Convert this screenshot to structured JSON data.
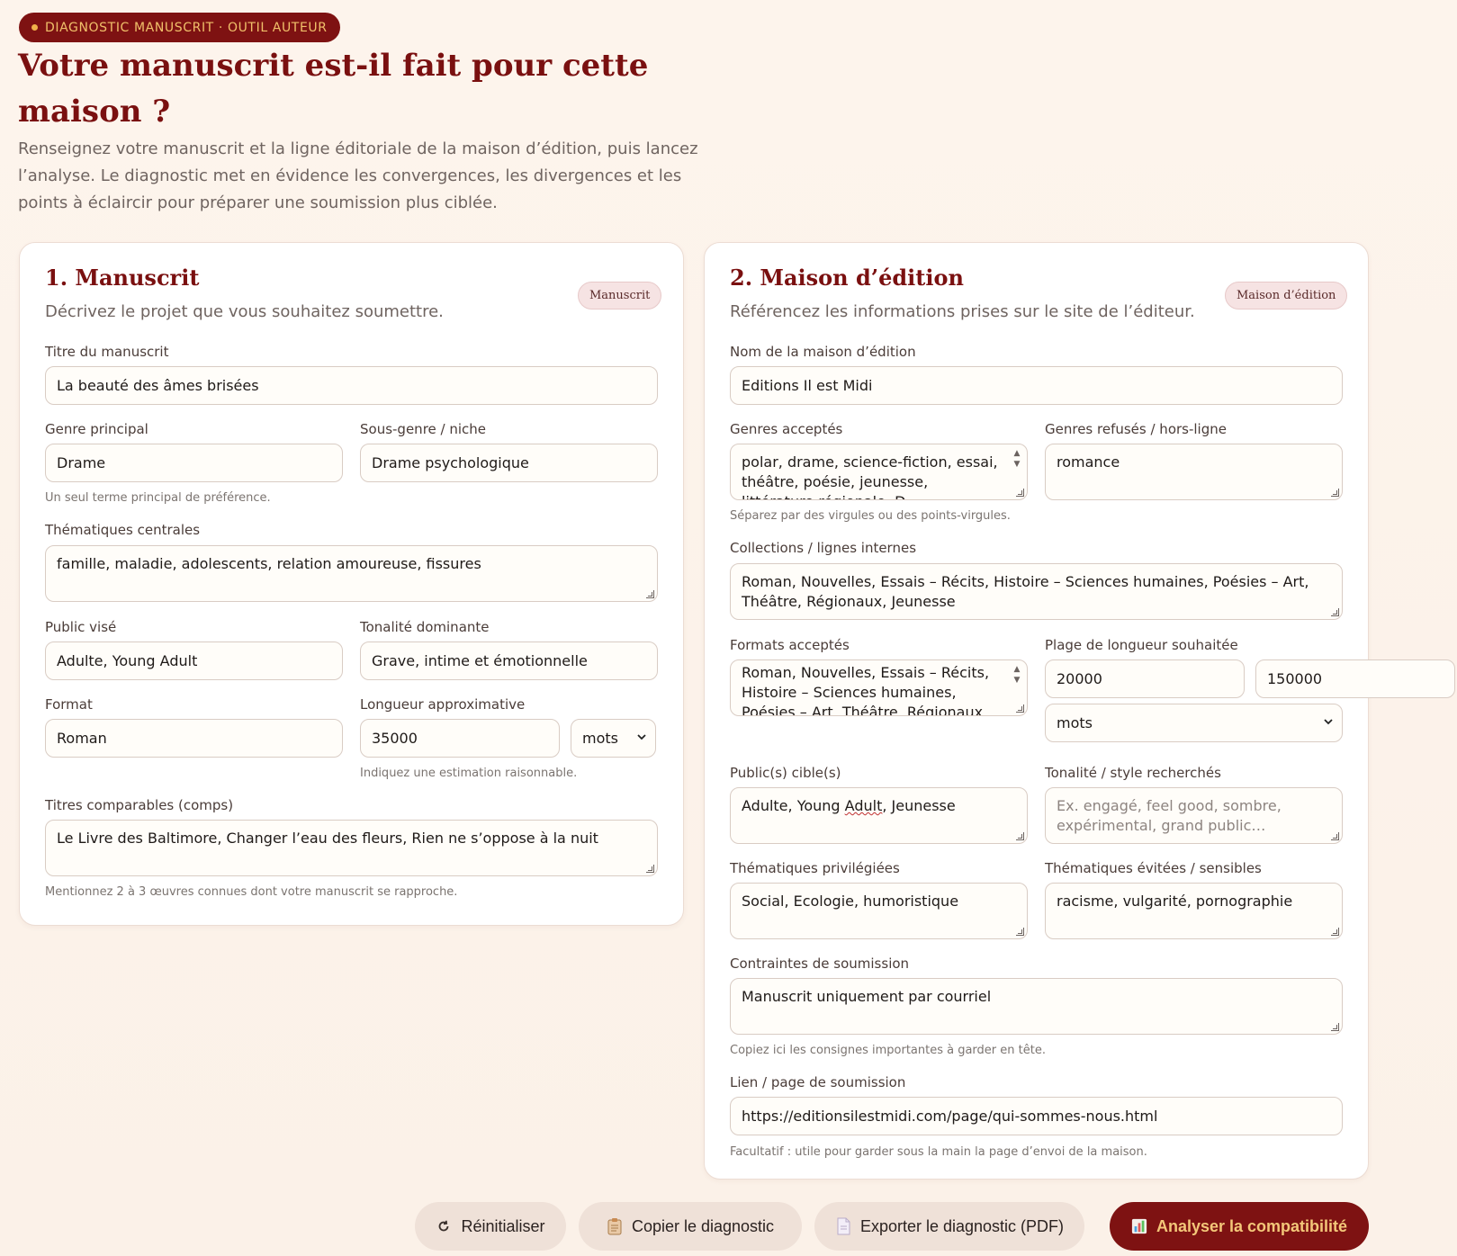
{
  "header": {
    "badge": "DIAGNOSTIC MANUSCRIT · OUTIL AUTEUR",
    "title": "Votre manuscrit est-il fait pour cette maison ?",
    "intro": "Renseignez votre manuscrit et la ligne éditoriale de la maison d’édition, puis lancez l’analyse. Le diagnostic met en évidence les convergences, les divergences et les points à éclaircir pour préparer une soumission plus ciblée."
  },
  "manuscrit": {
    "title": "1. Manuscrit",
    "subtitle": "Décrivez le projet que vous souhaitez soumettre.",
    "pill": "Manuscrit",
    "titre_label": "Titre du manuscrit",
    "titre_value": "La beauté des âmes brisées",
    "genre_label": "Genre principal",
    "genre_value": "Drame",
    "genre_hint": "Un seul terme principal de préférence.",
    "sousgenre_label": "Sous-genre / niche",
    "sousgenre_value": "Drame psychologique",
    "themes_label": "Thématiques centrales",
    "themes_value": "famille, maladie, adolescents, relation amoureuse, fissures",
    "public_label": "Public visé",
    "public_value": "Adulte, Young Adult",
    "tonalite_label": "Tonalité dominante",
    "tonalite_value": "Grave, intime et émotionnelle",
    "format_label": "Format",
    "format_value": "Roman",
    "longueur_label": "Longueur approximative",
    "longueur_value": "35000",
    "longueur_unit": "mots",
    "longueur_hint": "Indiquez une estimation raisonnable.",
    "comps_label": "Titres comparables (comps)",
    "comps_value": "Le Livre des Baltimore, Changer l’eau des fleurs, Rien ne s’oppose à la nuit",
    "comps_hint": "Mentionnez 2 à 3 œuvres connues dont votre manuscrit se rapproche."
  },
  "maison": {
    "title": "2. Maison d’édition",
    "subtitle": "Référencez les informations prises sur le site de l’éditeur.",
    "pill": "Maison d’édition",
    "nom_label": "Nom de la maison d’édition",
    "nom_value": "Editions Il est Midi",
    "acceptes_label": "Genres acceptés",
    "acceptes_value": "polar, drame, science-fiction, essai, théâtre, poésie, jeunesse, littérature régionale, D...",
    "acceptes_hint": "Séparez par des virgules ou des points-virgules.",
    "refuses_label": "Genres refusés / hors-ligne",
    "refuses_value": "romance",
    "collections_label": "Collections / lignes internes",
    "collections_value": "Roman, Nouvelles, Essais – Récits, Histoire – Sciences humaines, Poésies – Art, Théâtre, Régionaux, Jeunesse",
    "formats_label": "Formats acceptés",
    "formats_value": "Roman, Nouvelles, Essais – Récits, Histoire – Sciences humaines, Poésies – Art, Théâtre, Régionaux, Jeunesse",
    "plage_label": "Plage de longueur souhaitée",
    "plage_min": "20000",
    "plage_max": "150000",
    "plage_unit": "mots",
    "publics_label": "Public(s) cible(s)",
    "publics_value_a": "Adulte, Young ",
    "publics_value_b": "Adult",
    "publics_value_c": ", Jeunesse",
    "tonalite_label": "Tonalité / style recherchés",
    "tonalite_placeholder": "Ex. engagé, feel good, sombre, expérimental, grand public…",
    "themes_label": "Thématiques privilégiées",
    "themes_value": "Social, Ecologie, humoristique",
    "evitees_label": "Thématiques évitées / sensibles",
    "evitees_value": "racisme, vulgarité, pornographie",
    "contraintes_label": "Contraintes de soumission",
    "contraintes_value": "Manuscrit uniquement par courriel",
    "contraintes_hint": "Copiez ici les consignes importantes à garder en tête.",
    "lien_label": "Lien / page de soumission",
    "lien_value": "https://editionsilestmidi.com/page/qui-sommes-nous.html",
    "lien_hint": "Facultatif : utile pour garder sous la main la page d’envoi de la maison."
  },
  "actions": {
    "reset": "Réinitialiser",
    "copy": "Copier le diagnostic",
    "export": "Exporter le diagnostic (PDF)",
    "analyze": "Analyser la compatibilité"
  },
  "colors": {
    "accent": "#7e1212",
    "accent_text": "#f3c779",
    "background": "#fdf4ec"
  },
  "icons": {
    "reset": "refresh-icon",
    "copy": "clipboard-icon",
    "export": "document-icon",
    "analyze": "bar-chart-icon"
  }
}
